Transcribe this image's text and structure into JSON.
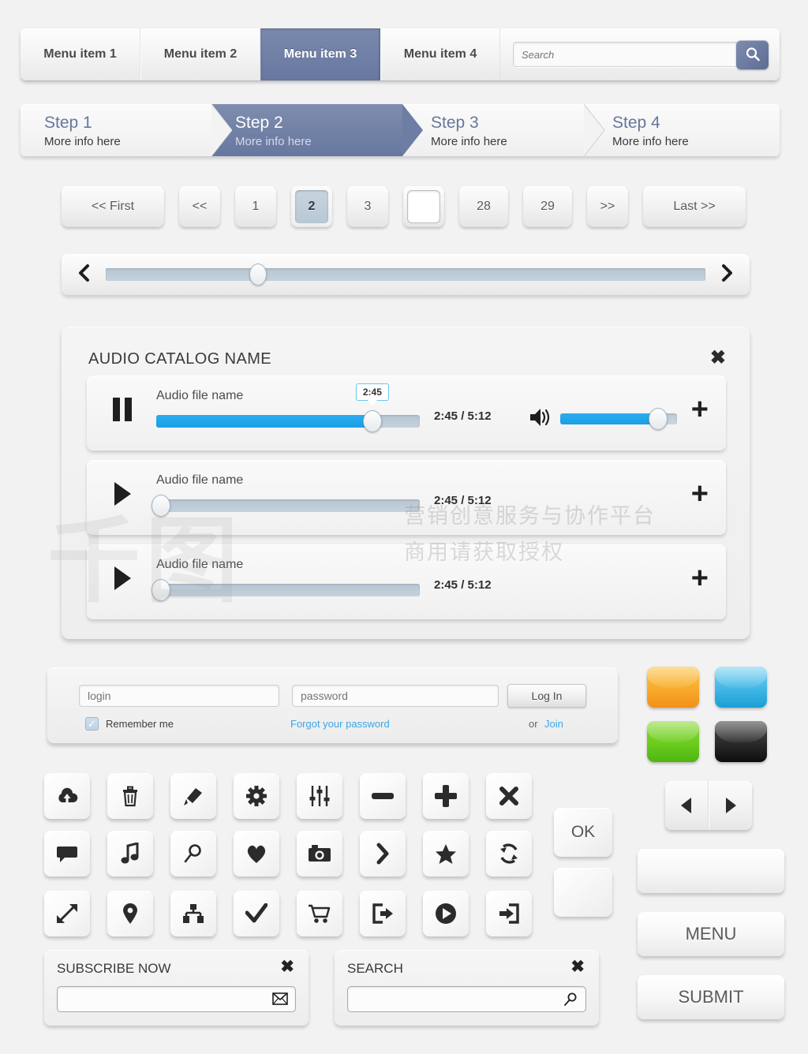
{
  "menu": {
    "items": [
      {
        "label": "Menu item 1",
        "active": false
      },
      {
        "label": "Menu item 2",
        "active": false
      },
      {
        "label": "Menu item 3",
        "active": true
      },
      {
        "label": "Menu item 4",
        "active": false
      }
    ],
    "search_placeholder": "Search",
    "search_icon": "magnifier-icon",
    "active_color": "#67779f"
  },
  "steps": [
    {
      "title": "Step 1",
      "info": "More info here"
    },
    {
      "title": "Step 2",
      "info": "More info here"
    },
    {
      "title": "Step 3",
      "info": "More info here"
    },
    {
      "title": "Step 4",
      "info": "More info here"
    }
  ],
  "steps_active_index": 1,
  "pagination": {
    "first": "<< First",
    "prev": "<<",
    "p1": "1",
    "p2": "2",
    "p3": "3",
    "blank": "",
    "p28": "28",
    "p29": "29",
    "next": ">>",
    "last": "Last >>",
    "current": "2"
  },
  "scrollbar": {
    "left_icon": "chevron-left-icon",
    "right_icon": "chevron-right-icon",
    "thumb_position_percent": 24
  },
  "audio": {
    "title": "AUDIO CATALOG NAME",
    "close_icon": "close-icon",
    "rows": [
      {
        "state": "pause",
        "name": "Audio file name",
        "tooltip": "2:45",
        "time": "2:45 / 5:12",
        "progress_percent": 82,
        "volume_percent": 84,
        "show_volume": true
      },
      {
        "state": "play",
        "name": "Audio file name",
        "tooltip": "",
        "time": "2:45 / 5:12",
        "progress_percent": 0,
        "volume_percent": 0,
        "show_volume": false
      },
      {
        "state": "play",
        "name": "Audio file name",
        "tooltip": "",
        "time": "2:45 / 5:12",
        "progress_percent": 0,
        "volume_percent": 0,
        "show_volume": false
      }
    ],
    "accent_color": "#1a9fe5",
    "add_label": "+"
  },
  "login": {
    "login_placeholder": "login",
    "password_placeholder": "password",
    "login_button": "Log In",
    "remember_label": "Remember me",
    "remember_checked": true,
    "forgot_label": "Forgot your password",
    "or_label": "or",
    "join_label": "Join",
    "link_color": "#3ba7e8"
  },
  "tiles": [
    {
      "name": "orange",
      "color": "#f8ad2e"
    },
    {
      "name": "blue",
      "color": "#46b9e6"
    },
    {
      "name": "green",
      "color": "#6ecd1f"
    },
    {
      "name": "black",
      "color": "#2d2d2d"
    }
  ],
  "icons": {
    "row1": [
      "cloud-upload-icon",
      "trash-icon",
      "pencil-icon",
      "gear-icon",
      "sliders-icon",
      "minus-icon",
      "plus-icon",
      "close-icon"
    ],
    "row2": [
      "chat-bubble-icon",
      "music-note-icon",
      "magnifier-icon",
      "heart-icon",
      "camera-icon",
      "chevron-right-icon",
      "star-icon",
      "refresh-icon"
    ],
    "row3": [
      "expand-icon",
      "map-pin-icon",
      "sitemap-icon",
      "check-icon",
      "cart-icon",
      "logout-icon",
      "play-circle-icon",
      "login-icon"
    ]
  },
  "misc_buttons": {
    "ok": "OK",
    "blank": "",
    "arrow_left_icon": "triangle-left-icon",
    "arrow_right_icon": "triangle-right-icon",
    "empty_bar": "",
    "menu": "MENU",
    "submit": "SUBMIT"
  },
  "subscribe_panel": {
    "title": "SUBSCRIBE NOW",
    "close_icon": "close-icon",
    "value": "",
    "placeholder": "",
    "field_icon": "envelope-icon"
  },
  "search_panel": {
    "title": "SEARCH",
    "close_icon": "close-icon",
    "value": "",
    "placeholder": "",
    "field_icon": "magnifier-icon"
  },
  "watermark": {
    "logo": "千图",
    "line1": "营销创意服务与协作平台",
    "line2": "商用请获取授权"
  }
}
